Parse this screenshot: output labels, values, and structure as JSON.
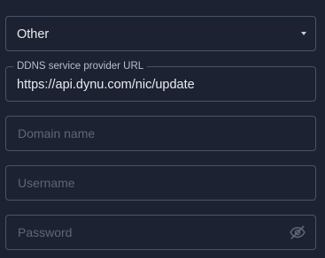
{
  "provider_select": {
    "value": "Other"
  },
  "url_field": {
    "label": "DDNS service provider URL",
    "value": "https://api.dynu.com/nic/update"
  },
  "domain_field": {
    "placeholder": "Domain name"
  },
  "username_field": {
    "placeholder": "Username"
  },
  "password_field": {
    "placeholder": "Password"
  },
  "icons": {
    "select_arrow": "chevron-down-icon",
    "password_toggle": "eye-off-icon"
  }
}
